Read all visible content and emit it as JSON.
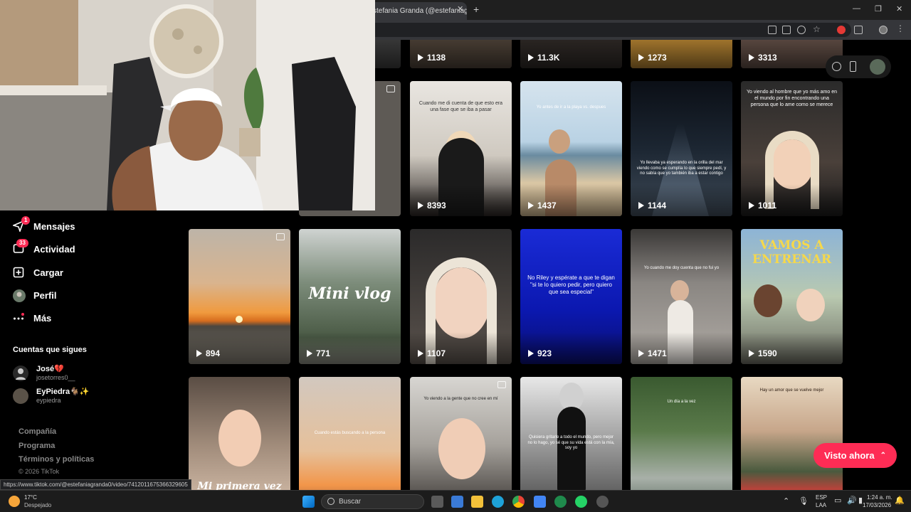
{
  "browser": {
    "tab_title": "stefania Granda (@estefaniag",
    "close_glyph": "✕",
    "new_tab_glyph": "+"
  },
  "grid": {
    "row1_views": [
      "1138",
      "11.3K",
      "1273",
      "3313"
    ],
    "row2": [
      {
        "views": "8393",
        "caption": "Cuando me di cuenta de que esto era una fase que se iba a pasar"
      },
      {
        "views": "1437",
        "caption": "Yo antes de ir a la playa vs. despues"
      },
      {
        "views": "1144",
        "caption": "Yo llevaba ya esperando en la orilla del mar viendo como se cumplía lo que siempre pedí, y no sabía que yo también iba a estar contigo"
      },
      {
        "views": "1011",
        "caption": "Yo viendo al hombre que yo más amo en el mundo por fin encontrando una persona que lo ame como se merece"
      }
    ],
    "row3": [
      {
        "views": "894",
        "caption": ""
      },
      {
        "views": "771",
        "title": "Mini vlog"
      },
      {
        "views": "1107",
        "caption": ""
      },
      {
        "views": "923",
        "caption": "No Riley y espérate a que te digan \"si te lo quiero pedir, pero quiero que sea especial\""
      },
      {
        "views": "1471",
        "caption": "Yo cuando me doy cuenta que no fui yo"
      },
      {
        "views": "1590",
        "title": "VAMOS A ENTRENAR"
      }
    ],
    "row4": [
      {
        "caption": "Mi primera vez"
      },
      {
        "caption": "Cuando estás buscando a la persona"
      },
      {
        "caption": "Yo viendo a la gente que no cree en mí"
      },
      {
        "caption": "Quisiera gritarle a todo el mundo, pero mejor no lo hago, yo sé que su vida está con la mía, soy yo"
      },
      {
        "caption": "Un día a la vez"
      },
      {
        "caption": "Hay un amor que se vuelve mejor"
      }
    ]
  },
  "sidebar": {
    "nav": [
      {
        "label": "Mensajes",
        "badge": "1",
        "icon": "send-icon"
      },
      {
        "label": "Actividad",
        "badge": "33",
        "icon": "inbox-icon"
      },
      {
        "label": "Cargar",
        "badge": "",
        "icon": "upload-icon"
      },
      {
        "label": "Perfil",
        "badge": "",
        "icon": "avatar-icon"
      },
      {
        "label": "Más",
        "badge": "",
        "icon": "more-icon"
      }
    ],
    "following_title": "Cuentas que sigues",
    "following": [
      {
        "name": "José💔",
        "handle": "josetorres0__"
      },
      {
        "name": "EyPiedra🐐✨",
        "handle": "eypiedra"
      }
    ],
    "footer": [
      "Compañía",
      "Programa",
      "Términos y políticas",
      "© 2026 TikTok"
    ]
  },
  "status_url": "https://www.tiktok.com/@estefaniagranda0/video/7412011675366329605",
  "visto_ahora": {
    "label": "Visto ahora",
    "glyph": "⌃"
  },
  "taskbar": {
    "temperature": "17°C",
    "weather": "Despejado",
    "search_placeholder": "Buscar",
    "lang": "ESP",
    "lang_sub": "LAA",
    "time": "1:24 a. m.",
    "date": "17/03/2026"
  },
  "colors": {
    "accent": "#fe2c55",
    "background": "#000000"
  }
}
